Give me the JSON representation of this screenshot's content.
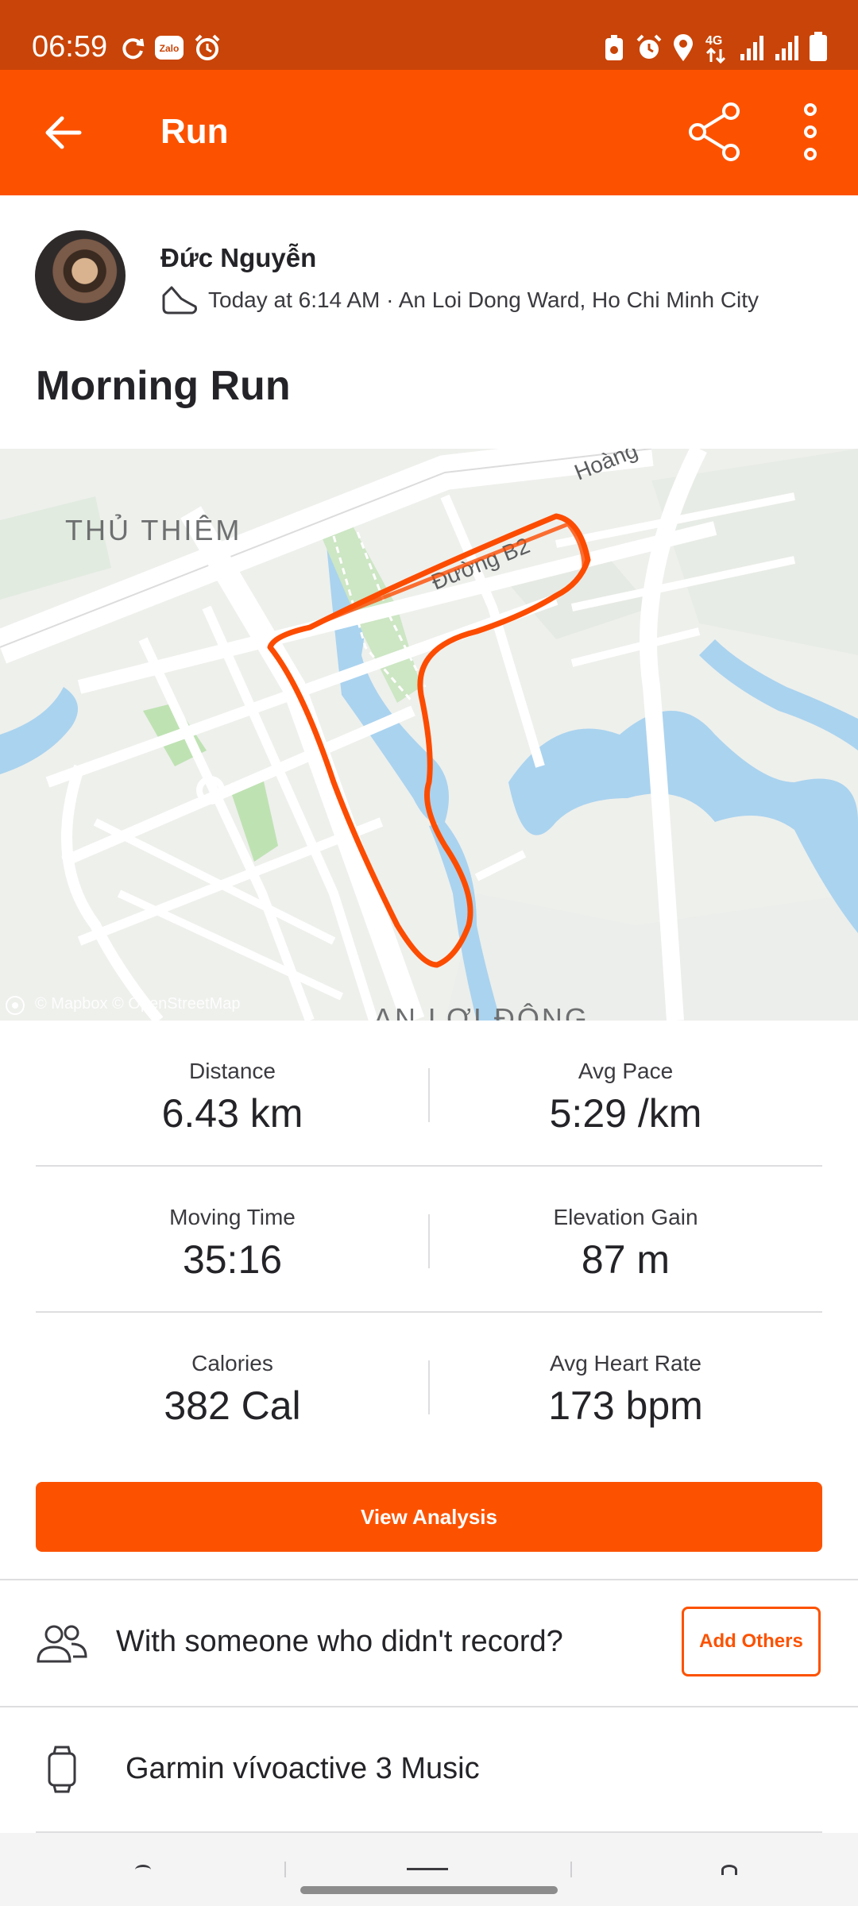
{
  "status_bar": {
    "time": "06:59",
    "notification_icons": [
      "sync-icon",
      "zalo-icon",
      "alarm-icon"
    ],
    "system_icons": [
      "battery-saver-icon",
      "alarm-icon",
      "location-icon",
      "network-4g-icon",
      "signal-icon",
      "signal-icon",
      "battery-icon"
    ],
    "zalo_label": "Zalo",
    "network_label": "4G"
  },
  "app_bar": {
    "title": "Run",
    "back_icon": "arrow-left-icon",
    "share_icon": "share-icon",
    "more_icon": "more-vertical-icon"
  },
  "athlete": {
    "name": "Đức Nguyễn",
    "activity_icon": "shoe-icon",
    "meta": "Today at 6:14 AM · An Loi Dong Ward, Ho Chi Minh City"
  },
  "activity": {
    "title": "Morning Run"
  },
  "map": {
    "labels": {
      "district": "THỦ THIÊM",
      "street": "Đường B2",
      "road_partial": "Hoàng",
      "ward_partial": "AN LỢI ĐÔNG"
    },
    "attribution": "© Mapbox © OpenStreetMap",
    "route_color": "#fc4c02"
  },
  "stats": [
    [
      {
        "label": "Distance",
        "value": "6.43 km"
      },
      {
        "label": "Avg Pace",
        "value": "5:29 /km"
      }
    ],
    [
      {
        "label": "Moving Time",
        "value": "35:16"
      },
      {
        "label": "Elevation Gain",
        "value": "87 m"
      }
    ],
    [
      {
        "label": "Calories",
        "value": "382 Cal"
      },
      {
        "label": "Avg Heart Rate",
        "value": "173 bpm"
      }
    ]
  ],
  "actions": {
    "view_analysis": "View Analysis",
    "with_others_prompt": "With someone who didn't record?",
    "add_others": "Add Others",
    "group_icon": "group-icon"
  },
  "device": {
    "name": "Garmin vívoactive 3 Music",
    "icon": "watch-icon"
  },
  "colors": {
    "brand": "#fc5200",
    "status_bar": "#c94408"
  }
}
